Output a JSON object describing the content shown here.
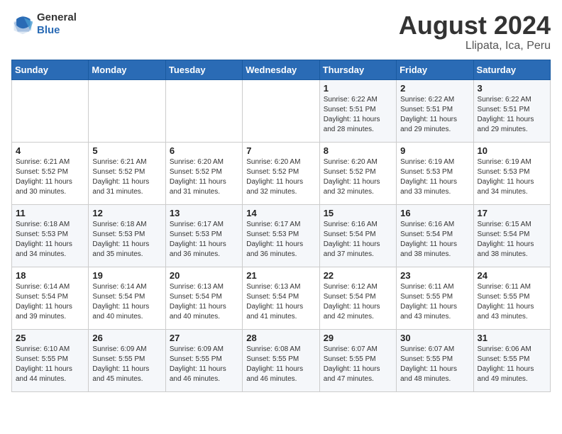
{
  "header": {
    "logo_line1": "General",
    "logo_line2": "Blue",
    "title": "August 2024",
    "subtitle": "Llipata, Ica, Peru"
  },
  "days_of_week": [
    "Sunday",
    "Monday",
    "Tuesday",
    "Wednesday",
    "Thursday",
    "Friday",
    "Saturday"
  ],
  "weeks": [
    [
      {
        "day": "",
        "info": ""
      },
      {
        "day": "",
        "info": ""
      },
      {
        "day": "",
        "info": ""
      },
      {
        "day": "",
        "info": ""
      },
      {
        "day": "1",
        "info": "Sunrise: 6:22 AM\nSunset: 5:51 PM\nDaylight: 11 hours\nand 28 minutes."
      },
      {
        "day": "2",
        "info": "Sunrise: 6:22 AM\nSunset: 5:51 PM\nDaylight: 11 hours\nand 29 minutes."
      },
      {
        "day": "3",
        "info": "Sunrise: 6:22 AM\nSunset: 5:51 PM\nDaylight: 11 hours\nand 29 minutes."
      }
    ],
    [
      {
        "day": "4",
        "info": "Sunrise: 6:21 AM\nSunset: 5:52 PM\nDaylight: 11 hours\nand 30 minutes."
      },
      {
        "day": "5",
        "info": "Sunrise: 6:21 AM\nSunset: 5:52 PM\nDaylight: 11 hours\nand 31 minutes."
      },
      {
        "day": "6",
        "info": "Sunrise: 6:20 AM\nSunset: 5:52 PM\nDaylight: 11 hours\nand 31 minutes."
      },
      {
        "day": "7",
        "info": "Sunrise: 6:20 AM\nSunset: 5:52 PM\nDaylight: 11 hours\nand 32 minutes."
      },
      {
        "day": "8",
        "info": "Sunrise: 6:20 AM\nSunset: 5:52 PM\nDaylight: 11 hours\nand 32 minutes."
      },
      {
        "day": "9",
        "info": "Sunrise: 6:19 AM\nSunset: 5:53 PM\nDaylight: 11 hours\nand 33 minutes."
      },
      {
        "day": "10",
        "info": "Sunrise: 6:19 AM\nSunset: 5:53 PM\nDaylight: 11 hours\nand 34 minutes."
      }
    ],
    [
      {
        "day": "11",
        "info": "Sunrise: 6:18 AM\nSunset: 5:53 PM\nDaylight: 11 hours\nand 34 minutes."
      },
      {
        "day": "12",
        "info": "Sunrise: 6:18 AM\nSunset: 5:53 PM\nDaylight: 11 hours\nand 35 minutes."
      },
      {
        "day": "13",
        "info": "Sunrise: 6:17 AM\nSunset: 5:53 PM\nDaylight: 11 hours\nand 36 minutes."
      },
      {
        "day": "14",
        "info": "Sunrise: 6:17 AM\nSunset: 5:53 PM\nDaylight: 11 hours\nand 36 minutes."
      },
      {
        "day": "15",
        "info": "Sunrise: 6:16 AM\nSunset: 5:54 PM\nDaylight: 11 hours\nand 37 minutes."
      },
      {
        "day": "16",
        "info": "Sunrise: 6:16 AM\nSunset: 5:54 PM\nDaylight: 11 hours\nand 38 minutes."
      },
      {
        "day": "17",
        "info": "Sunrise: 6:15 AM\nSunset: 5:54 PM\nDaylight: 11 hours\nand 38 minutes."
      }
    ],
    [
      {
        "day": "18",
        "info": "Sunrise: 6:14 AM\nSunset: 5:54 PM\nDaylight: 11 hours\nand 39 minutes."
      },
      {
        "day": "19",
        "info": "Sunrise: 6:14 AM\nSunset: 5:54 PM\nDaylight: 11 hours\nand 40 minutes."
      },
      {
        "day": "20",
        "info": "Sunrise: 6:13 AM\nSunset: 5:54 PM\nDaylight: 11 hours\nand 40 minutes."
      },
      {
        "day": "21",
        "info": "Sunrise: 6:13 AM\nSunset: 5:54 PM\nDaylight: 11 hours\nand 41 minutes."
      },
      {
        "day": "22",
        "info": "Sunrise: 6:12 AM\nSunset: 5:54 PM\nDaylight: 11 hours\nand 42 minutes."
      },
      {
        "day": "23",
        "info": "Sunrise: 6:11 AM\nSunset: 5:55 PM\nDaylight: 11 hours\nand 43 minutes."
      },
      {
        "day": "24",
        "info": "Sunrise: 6:11 AM\nSunset: 5:55 PM\nDaylight: 11 hours\nand 43 minutes."
      }
    ],
    [
      {
        "day": "25",
        "info": "Sunrise: 6:10 AM\nSunset: 5:55 PM\nDaylight: 11 hours\nand 44 minutes."
      },
      {
        "day": "26",
        "info": "Sunrise: 6:09 AM\nSunset: 5:55 PM\nDaylight: 11 hours\nand 45 minutes."
      },
      {
        "day": "27",
        "info": "Sunrise: 6:09 AM\nSunset: 5:55 PM\nDaylight: 11 hours\nand 46 minutes."
      },
      {
        "day": "28",
        "info": "Sunrise: 6:08 AM\nSunset: 5:55 PM\nDaylight: 11 hours\nand 46 minutes."
      },
      {
        "day": "29",
        "info": "Sunrise: 6:07 AM\nSunset: 5:55 PM\nDaylight: 11 hours\nand 47 minutes."
      },
      {
        "day": "30",
        "info": "Sunrise: 6:07 AM\nSunset: 5:55 PM\nDaylight: 11 hours\nand 48 minutes."
      },
      {
        "day": "31",
        "info": "Sunrise: 6:06 AM\nSunset: 5:55 PM\nDaylight: 11 hours\nand 49 minutes."
      }
    ]
  ]
}
